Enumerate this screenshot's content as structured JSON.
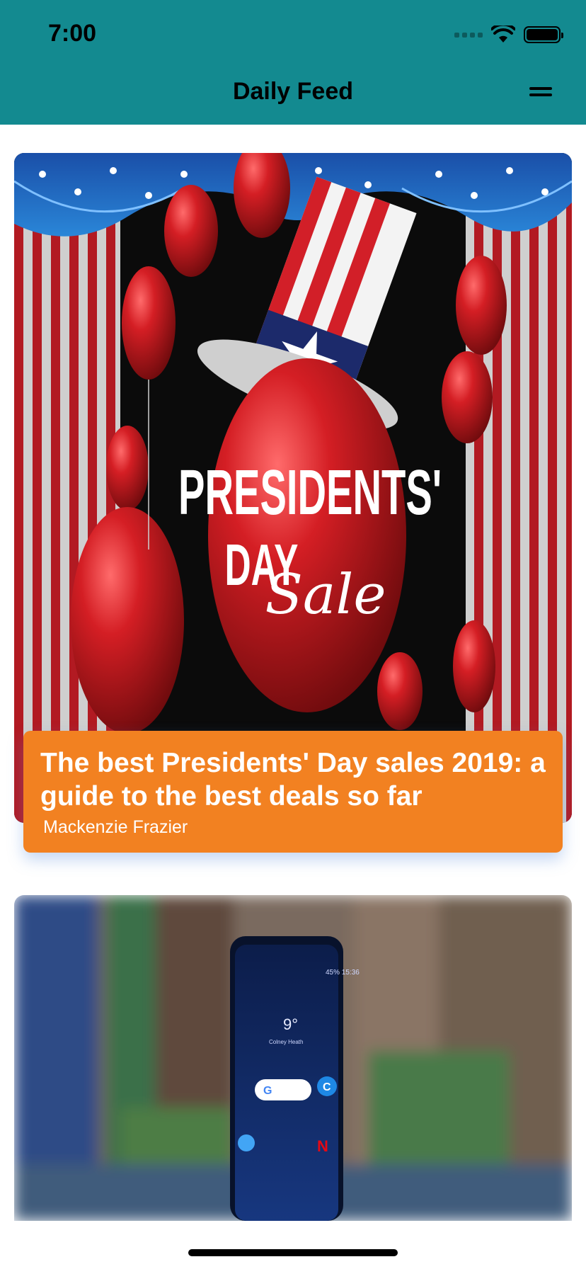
{
  "status_bar": {
    "time": "7:00"
  },
  "header": {
    "title": "Daily Feed",
    "background": "#138a90"
  },
  "feed": {
    "articles": [
      {
        "image_text_line1": "PRESIDENTS'",
        "image_text_line2": "DAY",
        "image_text_script": "Sale",
        "title": "The best Presidents' Day sales 2019: a guide to the best deals so far",
        "author": "Mackenzie Frazier",
        "caption_color": "#f28121"
      },
      {
        "image_description_icons": [
          "google-search-widget",
          "sap-concur-app",
          "connect-app",
          "netflix-app"
        ]
      }
    ]
  }
}
